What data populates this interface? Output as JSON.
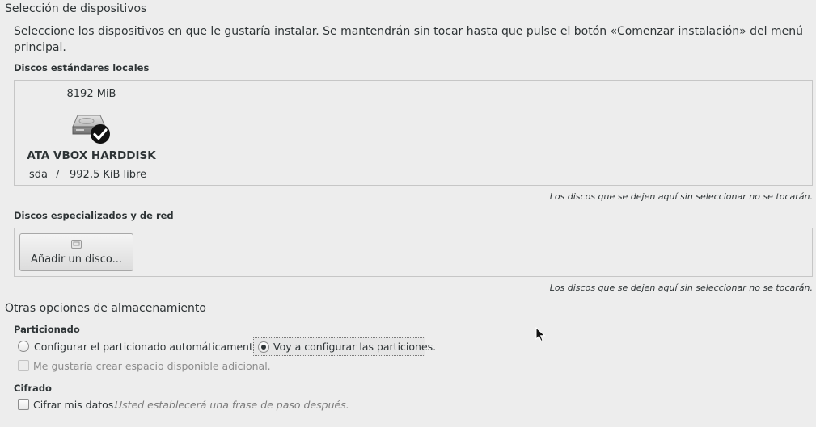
{
  "title": "Selección de dispositivos",
  "description": "Seleccione los dispositivos en que le gustaría instalar. Se mantendrán sin tocar hasta que pulse el botón «Comenzar instalación» del menú principal.",
  "local_disks": {
    "heading": "Discos estándares locales",
    "disks": [
      {
        "size": "8192 MiB",
        "name": "ATA VBOX HARDDISK",
        "device": "sda",
        "separator": "/",
        "free": "992,5 KiB libre",
        "selected": true
      }
    ],
    "note": "Los discos que se dejen aquí sin seleccionar no se tocarán."
  },
  "specialized_disks": {
    "heading": "Discos especializados y de red",
    "add_button": "Añadir un disco...",
    "note": "Los discos que se dejen aquí sin seleccionar no se tocarán."
  },
  "other_options": {
    "title": "Otras opciones de almacenamiento",
    "partitioning": {
      "heading": "Particionado",
      "auto_label": "Configurar el particionado automáticamente.",
      "manual_label": "Voy a configurar las particiones.",
      "selected": "manual",
      "extra_space_label": "Me gustaría crear espacio disponible adicional.",
      "extra_space_enabled": false
    },
    "encryption": {
      "heading": "Cifrado",
      "encrypt_label": "Cifrar mis datos.",
      "encrypt_hint": "Usted establecerá una frase de paso después.",
      "checked": false
    }
  },
  "icons": {
    "disk": "harddisk-icon",
    "selected": "checkmark-badge-icon",
    "add_disk": "disk-add-icon",
    "cursor": "mouse-pointer-icon"
  }
}
